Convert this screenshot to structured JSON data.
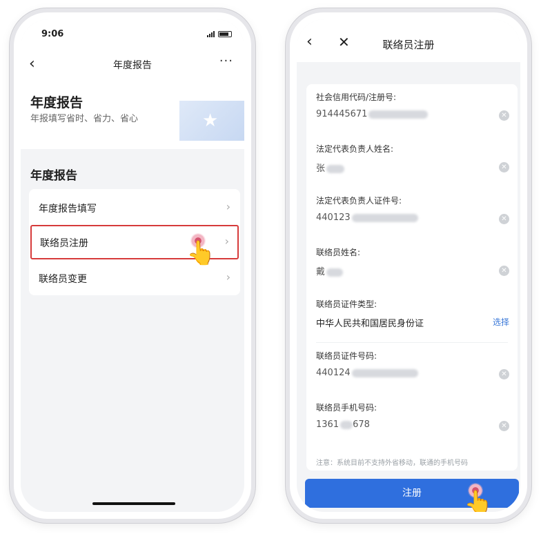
{
  "left": {
    "status": {
      "time": "9:06"
    },
    "nav": {
      "back": "‹",
      "title": "年度报告",
      "more": "···"
    },
    "hero": {
      "title": "年度报告",
      "subtitle": "年报填写省时、省力、省心"
    },
    "section_title": "年度报告",
    "menu": [
      {
        "label": "年度报告填写"
      },
      {
        "label": "联络员注册"
      },
      {
        "label": "联络员变更"
      }
    ],
    "chevron": "›"
  },
  "right": {
    "nav": {
      "back": "‹",
      "close": "✕",
      "title": "联络员注册"
    },
    "fields": [
      {
        "label": "社会信用代码/注册号:",
        "value": "914445671"
      },
      {
        "label": "法定代表负责人姓名:",
        "value": "张"
      },
      {
        "label": "法定代表负责人证件号:",
        "value": "440123"
      },
      {
        "label": "联络员姓名:",
        "value": "戴"
      },
      {
        "label": "联络员证件类型:",
        "value": "中华人民共和国居民身份证",
        "action": "选择"
      },
      {
        "label": "联络员证件号码:",
        "value": "440124"
      },
      {
        "label": "联络员手机号码:",
        "value": "1361",
        "value_tail": "678"
      }
    ],
    "clear_glyph": "✕",
    "notice": "注意：系统目前不支持外省移动，联通的手机号码",
    "submit": "注册"
  },
  "icons": {
    "star": "★",
    "hand": "👆"
  },
  "colors": {
    "highlight_border": "#d63a3a",
    "primary": "#2f6fde",
    "link": "#3a78d8"
  }
}
